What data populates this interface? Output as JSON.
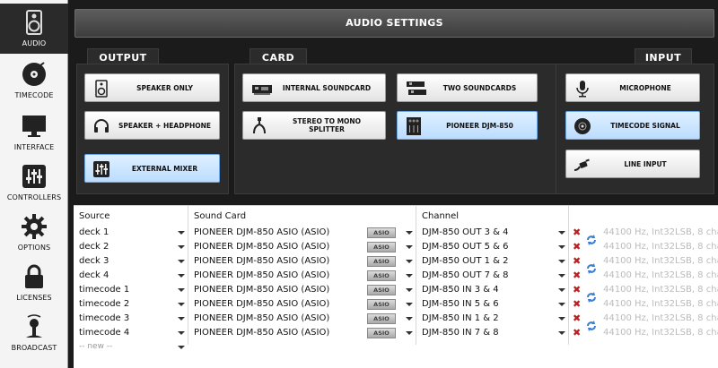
{
  "sidebar": {
    "items": [
      {
        "label": "AUDIO",
        "icon": "speaker-icon",
        "active": true
      },
      {
        "label": "TIMECODE",
        "icon": "vinyl-icon"
      },
      {
        "label": "INTERFACE",
        "icon": "monitor-icon"
      },
      {
        "label": "CONTROLLERS",
        "icon": "mixer-icon"
      },
      {
        "label": "OPTIONS",
        "icon": "gear-icon"
      },
      {
        "label": "LICENSES",
        "icon": "lock-icon"
      },
      {
        "label": "BROADCAST",
        "icon": "broadcast-icon"
      }
    ]
  },
  "header": {
    "title": "AUDIO SETTINGS"
  },
  "output": {
    "tab": "OUTPUT",
    "buttons": [
      {
        "label": "SPEAKER ONLY",
        "icon": "speaker-icon",
        "selected": false
      },
      {
        "label": "SPEAKER + HEADPHONE",
        "icon": "headphones-icon",
        "selected": false
      },
      {
        "label": "EXTERNAL MIXER",
        "icon": "mixer-icon",
        "selected": true
      }
    ]
  },
  "card": {
    "tab": "CARD",
    "buttons": [
      {
        "label": "INTERNAL SOUNDCARD",
        "icon": "soundcard-icon",
        "selected": false
      },
      {
        "label": "TWO SOUNDCARDS",
        "icon": "two-soundcards-icon",
        "selected": false
      },
      {
        "label": "STEREO TO MONO SPLITTER",
        "icon": "splitter-cable-icon",
        "selected": false
      },
      {
        "label": "PIONEER DJM-850",
        "icon": "dj-mixer-device-icon",
        "selected": true
      }
    ]
  },
  "input": {
    "tab": "INPUT",
    "buttons": [
      {
        "label": "MICROPHONE",
        "icon": "microphone-icon",
        "selected": false
      },
      {
        "label": "TIMECODE SIGNAL",
        "icon": "timecode-disc-icon",
        "selected": true
      },
      {
        "label": "LINE INPUT",
        "icon": "line-cable-icon",
        "selected": false
      }
    ]
  },
  "table": {
    "headers": {
      "source": "Source",
      "soundcard": "Sound Card",
      "channel": "Channel"
    },
    "asio_label": "ASIO",
    "remove_icon": "close-icon",
    "refresh_icon": "refresh-icon",
    "info": "44100 Hz, Int32LSB, 8 cha",
    "rows": [
      {
        "source": "deck 1",
        "card": "PIONEER DJM-850 ASIO (ASIO)",
        "channel": "DJM-850 OUT 3 & 4"
      },
      {
        "source": "deck 2",
        "card": "PIONEER DJM-850 ASIO (ASIO)",
        "channel": "DJM-850 OUT 5 & 6"
      },
      {
        "source": "deck 3",
        "card": "PIONEER DJM-850 ASIO (ASIO)",
        "channel": "DJM-850 OUT 1 & 2"
      },
      {
        "source": "deck 4",
        "card": "PIONEER DJM-850 ASIO (ASIO)",
        "channel": "DJM-850 OUT 7 & 8"
      },
      {
        "source": "timecode 1",
        "card": "PIONEER DJM-850 ASIO (ASIO)",
        "channel": "DJM-850 IN 3 & 4"
      },
      {
        "source": "timecode 2",
        "card": "PIONEER DJM-850 ASIO (ASIO)",
        "channel": "DJM-850 IN 5 & 6"
      },
      {
        "source": "timecode 3",
        "card": "PIONEER DJM-850 ASIO (ASIO)",
        "channel": "DJM-850 IN 1 & 2"
      },
      {
        "source": "timecode 4",
        "card": "PIONEER DJM-850 ASIO (ASIO)",
        "channel": "DJM-850 IN 7 & 8"
      }
    ],
    "new_row": "-- new --"
  }
}
